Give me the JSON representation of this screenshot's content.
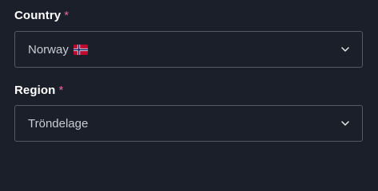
{
  "country": {
    "label": "Country",
    "required_mark": "*",
    "value": "Norway",
    "flag_icon": "norway-flag-icon",
    "dropdown_icon": "chevron-down-icon"
  },
  "region": {
    "label": "Region",
    "required_mark": "*",
    "value": "Tröndelage",
    "dropdown_icon": "chevron-down-icon"
  },
  "colors": {
    "background": "#1b1f2a",
    "label": "#ffffff",
    "required": "#e1699d",
    "border": "#525a67",
    "value_text": "#c8ccd3"
  }
}
